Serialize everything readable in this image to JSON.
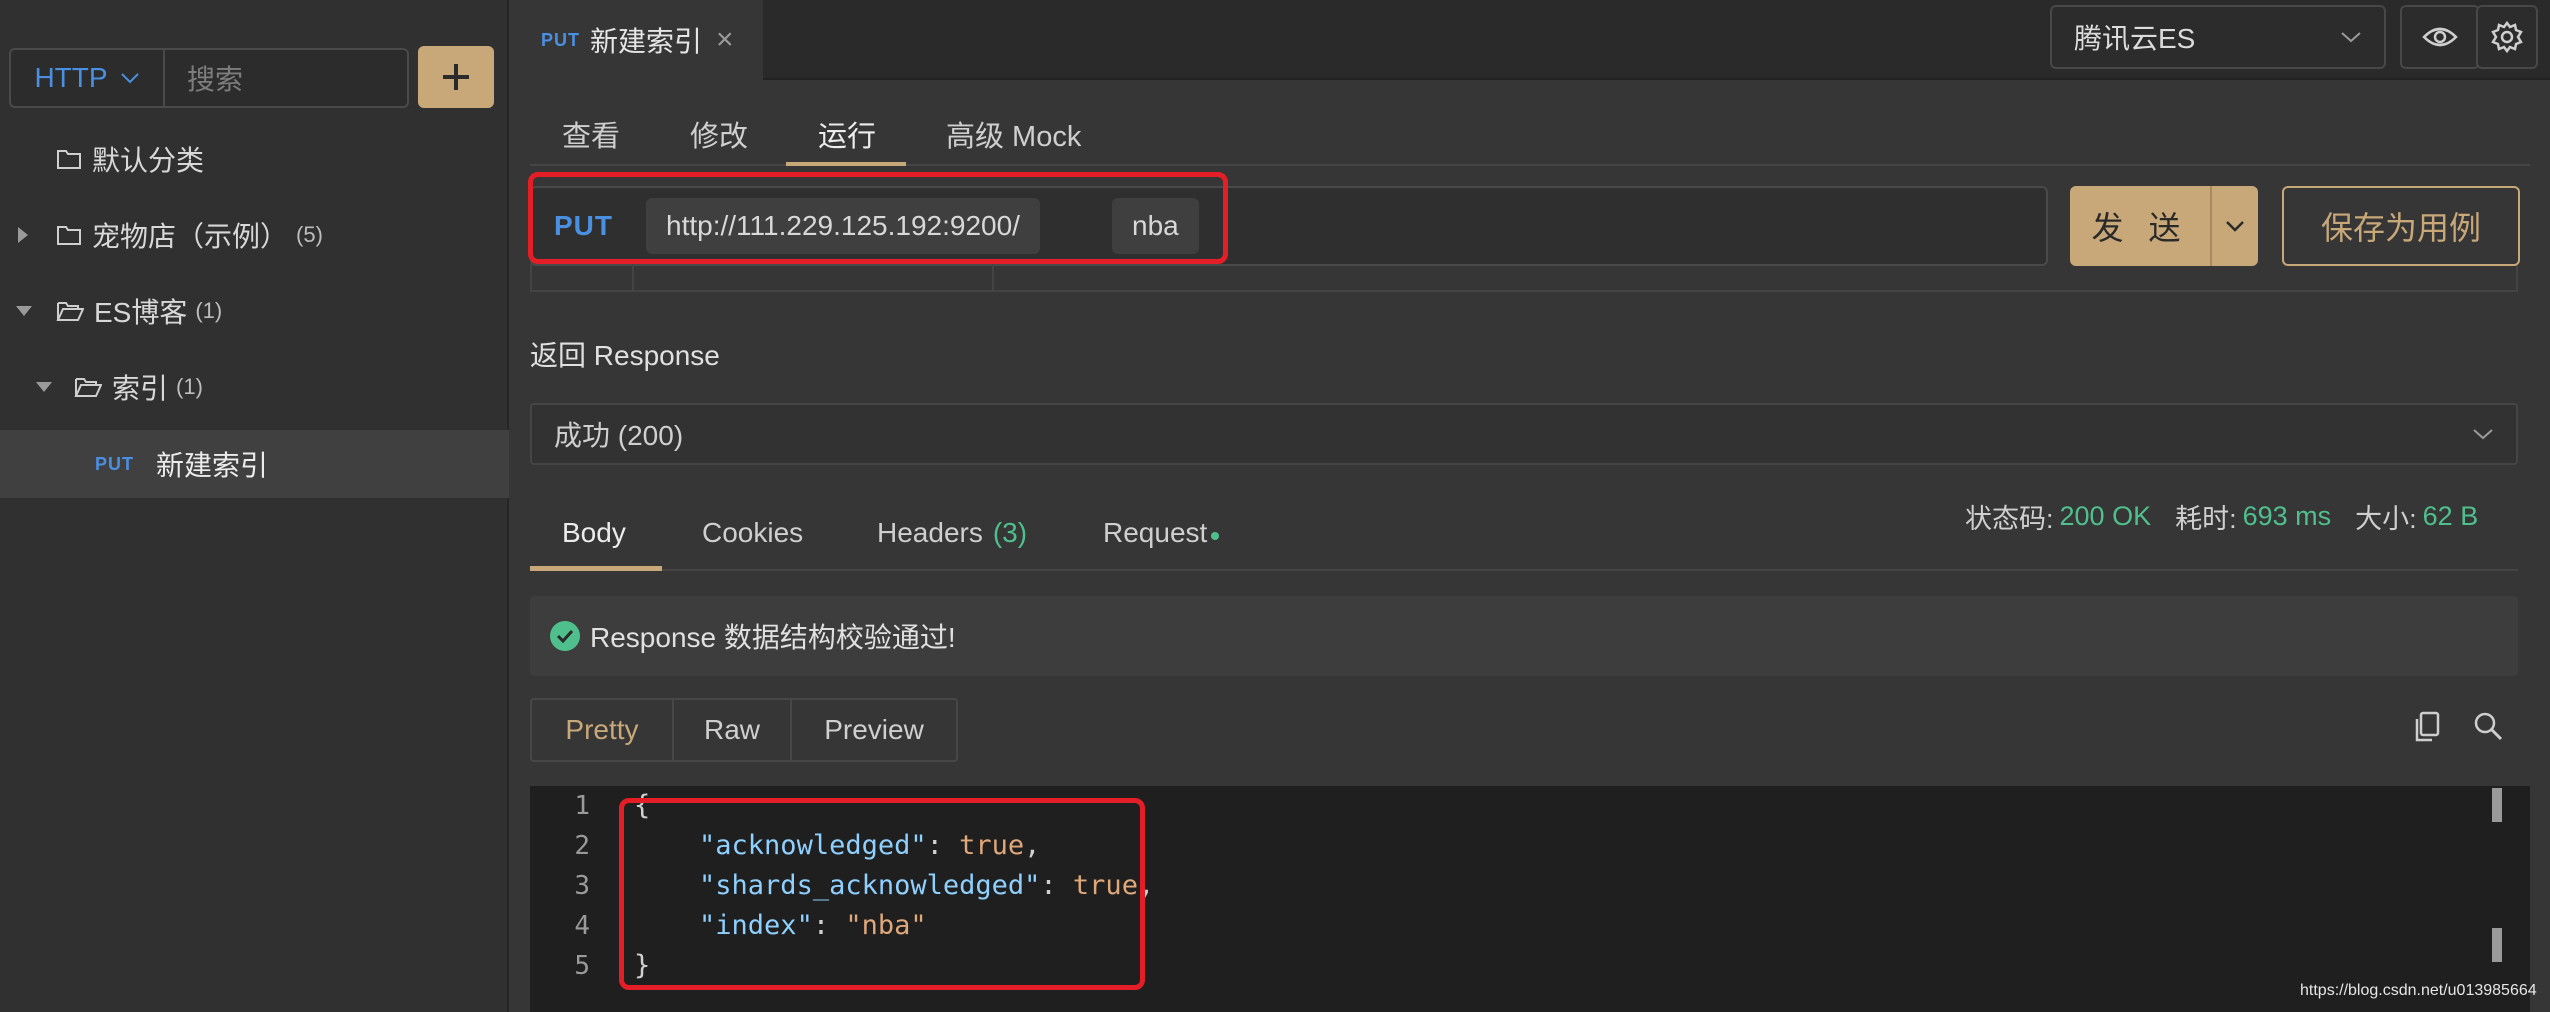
{
  "sidebar": {
    "protocol": "HTTP",
    "search_placeholder": "搜索",
    "add_label": "+",
    "tree": [
      {
        "label": "默认分类",
        "count": ""
      },
      {
        "label": "宠物店（示例）",
        "count": "(5)"
      },
      {
        "label": "ES博客",
        "count": "(1)"
      },
      {
        "label": "索引",
        "count": "(1)"
      },
      {
        "method": "PUT",
        "label": "新建索引"
      }
    ]
  },
  "tab": {
    "method": "PUT",
    "title": "新建索引",
    "close": "×"
  },
  "env": {
    "selected": "腾讯云ES"
  },
  "subtabs": [
    "查看",
    "修改",
    "运行",
    "高级 Mock"
  ],
  "request": {
    "method": "PUT",
    "base_url": "http://111.229.125.192:9200/",
    "path": "nba",
    "send_label": "发 送",
    "save_label": "保存为用例"
  },
  "response": {
    "title": "返回 Response",
    "selected": "成功 (200)",
    "tabs": {
      "body": "Body",
      "cookies": "Cookies",
      "headers": "Headers",
      "headers_count": "(3)",
      "request": "Request"
    },
    "stats": {
      "status_label": "状态码:",
      "status_value": "200 OK",
      "time_label": "耗时:",
      "time_value": "693 ms",
      "size_label": "大小:",
      "size_value": "62 B"
    },
    "validation": "Response 数据结构校验通过!",
    "views": [
      "Pretty",
      "Raw",
      "Preview"
    ],
    "line_numbers": [
      "1",
      "2",
      "3",
      "4",
      "5"
    ],
    "code": {
      "open": "{",
      "l2_key": "\"acknowledged\"",
      "l2_val": "true",
      "l3_key": "\"shards_acknowledged\"",
      "l3_val": "true",
      "l4_key": "\"index\"",
      "l4_val": "\"nba\"",
      "close": "}"
    }
  },
  "watermark": "https://blog.csdn.net/u013985664",
  "colors": {
    "accent": "#c8a879",
    "method_blue": "#4a90e2",
    "success_green": "#4fc08d",
    "highlight_red": "#e41e26"
  }
}
